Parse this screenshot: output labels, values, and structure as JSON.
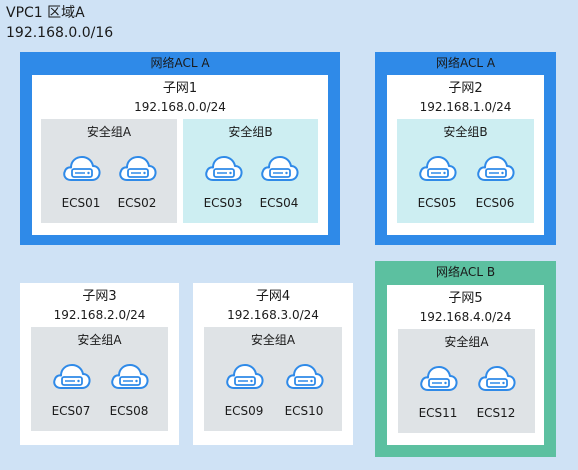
{
  "vpc": {
    "title": "VPC1 区域A",
    "cidr": "192.168.0.0/16"
  },
  "acls": [
    {
      "label": "网络ACL A",
      "color": "#2f8ae8"
    },
    {
      "label": "网络ACL A",
      "color": "#2f8ae8"
    },
    {
      "label": "网络ACL B",
      "color": "#5cc0a0"
    }
  ],
  "subnets": [
    {
      "name": "子网1",
      "cidr": "192.168.0.0/24"
    },
    {
      "name": "子网2",
      "cidr": "192.168.1.0/24"
    },
    {
      "name": "子网3",
      "cidr": "192.168.2.0/24"
    },
    {
      "name": "子网4",
      "cidr": "192.168.3.0/24"
    },
    {
      "name": "子网5",
      "cidr": "192.168.4.0/24"
    }
  ],
  "security_groups": [
    {
      "label": "安全组A",
      "color": "#dfe3e6"
    },
    {
      "label": "安全组B",
      "color": "#cdeef2"
    },
    {
      "label": "安全组B",
      "color": "#cdeef2"
    },
    {
      "label": "安全组A",
      "color": "#dfe3e6"
    },
    {
      "label": "安全组A",
      "color": "#dfe3e6"
    },
    {
      "label": "安全组A",
      "color": "#dfe3e6"
    }
  ],
  "ecs": [
    "ECS01",
    "ECS02",
    "ECS03",
    "ECS04",
    "ECS05",
    "ECS06",
    "ECS07",
    "ECS08",
    "ECS09",
    "ECS10",
    "ECS11",
    "ECS12"
  ],
  "icon_name": "cloud-server-icon"
}
